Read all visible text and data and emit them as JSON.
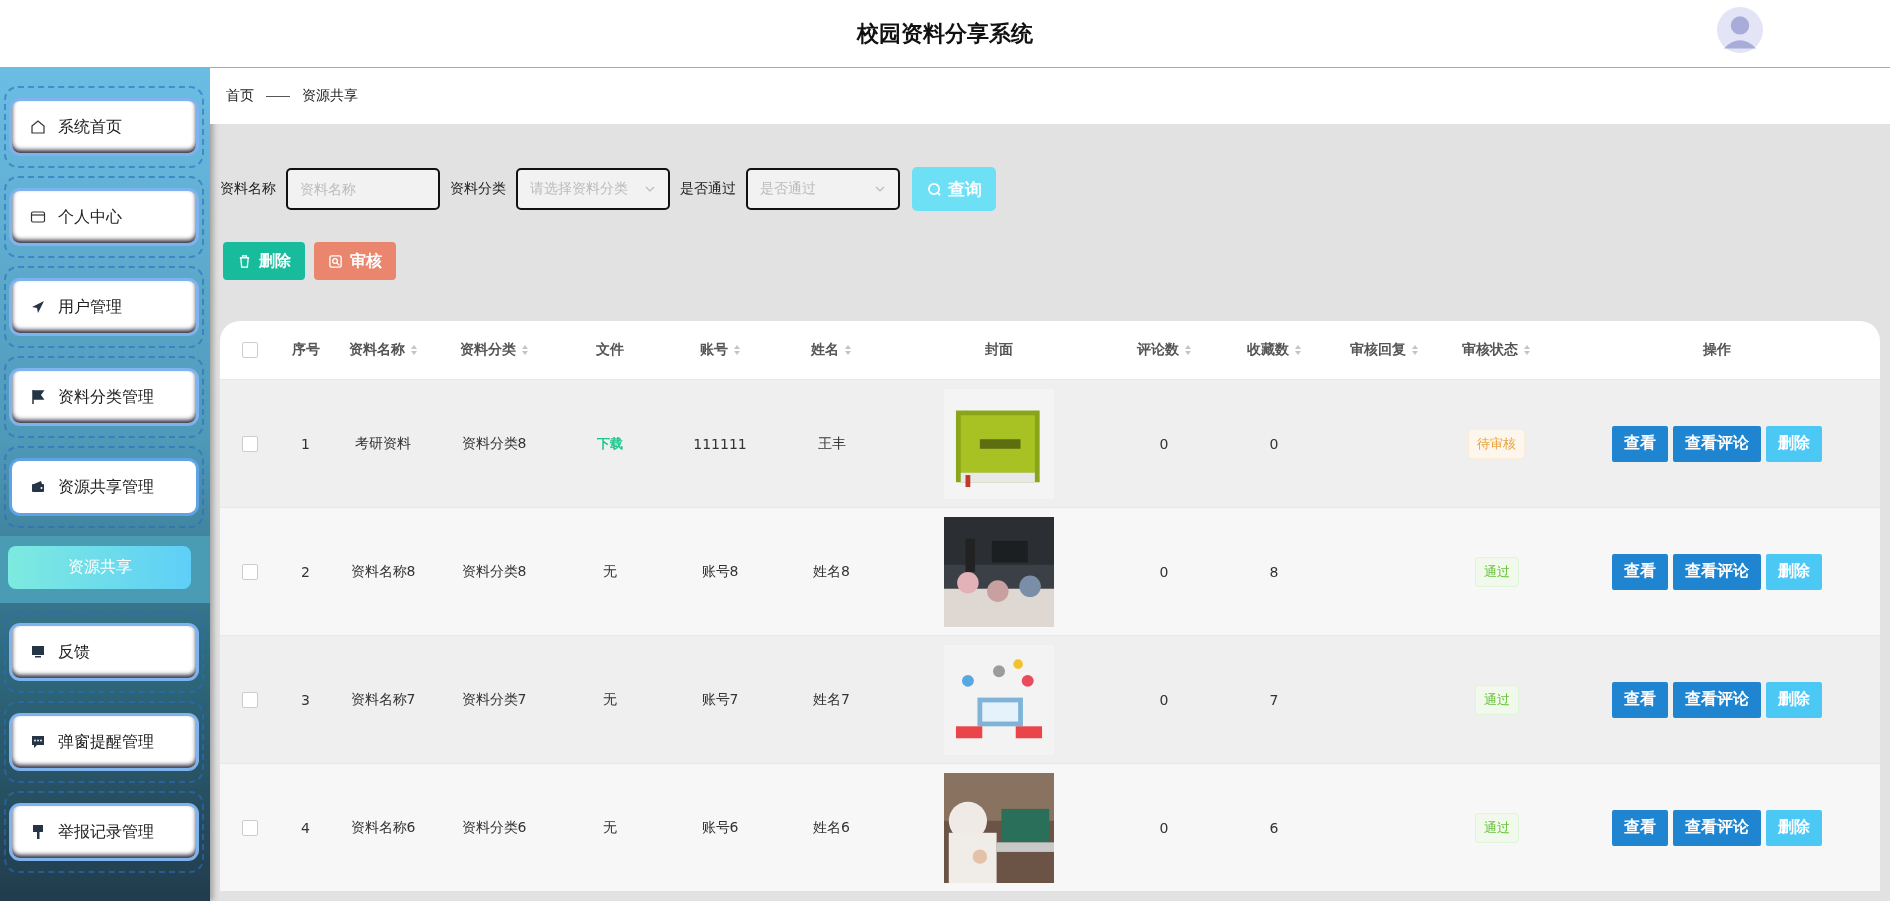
{
  "header": {
    "title": "校园资料分享系统"
  },
  "sidebar": {
    "items": [
      {
        "label": "系统首页",
        "expanded": false
      },
      {
        "label": "个人中心",
        "expanded": false
      },
      {
        "label": "用户管理",
        "expanded": false
      },
      {
        "label": "资料分类管理",
        "expanded": false
      },
      {
        "label": "资源共享管理",
        "expanded": true,
        "children": [
          {
            "label": "资源共享",
            "selected": true
          }
        ]
      },
      {
        "label": "反馈",
        "expanded": false
      },
      {
        "label": "弹窗提醒管理",
        "expanded": false
      },
      {
        "label": "举报记录管理",
        "expanded": false
      }
    ]
  },
  "breadcrumb": [
    "首页",
    "资源共享"
  ],
  "search": {
    "fields": [
      {
        "label": "资料名称",
        "placeholder": "资料名称",
        "kind": "text"
      },
      {
        "label": "资料分类",
        "placeholder": "请选择资料分类",
        "kind": "select"
      },
      {
        "label": "是否通过",
        "placeholder": "是否通过",
        "kind": "select"
      }
    ],
    "button": "查询"
  },
  "actions": [
    {
      "label": "删除",
      "kind": "delete"
    },
    {
      "label": "审核",
      "kind": "review"
    }
  ],
  "table": {
    "header_checked": false,
    "columns": [
      {
        "label": "序号",
        "sortable": false
      },
      {
        "label": "资料名称",
        "sortable": true
      },
      {
        "label": "资料分类",
        "sortable": true
      },
      {
        "label": "文件",
        "sortable": false
      },
      {
        "label": "账号",
        "sortable": true
      },
      {
        "label": "姓名",
        "sortable": true
      },
      {
        "label": "封面",
        "sortable": false
      },
      {
        "label": "评论数",
        "sortable": true
      },
      {
        "label": "收藏数",
        "sortable": true
      },
      {
        "label": "审核回复",
        "sortable": true
      },
      {
        "label": "审核状态",
        "sortable": true
      },
      {
        "label": "操作",
        "sortable": false
      }
    ],
    "rows": [
      {
        "checked": false,
        "no": "1",
        "name": "考研资料",
        "category": "资料分类8",
        "file": "下载",
        "file_link": true,
        "account": "111111",
        "person": "王丰",
        "cover": {
          "kind": "picture"
        },
        "comments": "0",
        "favorites": "0",
        "status": "待审核",
        "approved": false,
        "buttons": [
          "查看",
          "查看评论",
          "删除"
        ]
      },
      {
        "checked": false,
        "no": "2",
        "name": "资料名称8",
        "category": "资料分类8",
        "file": "无",
        "file_link": false,
        "account": "账号8",
        "person": "姓名8",
        "cover": {
          "kind": "picture"
        },
        "comments": "0",
        "favorites": "8",
        "status": "通过",
        "approved": true,
        "buttons": [
          "查看",
          "查看评论",
          "删除"
        ]
      },
      {
        "checked": false,
        "no": "3",
        "name": "资料名称7",
        "category": "资料分类7",
        "file": "无",
        "file_link": false,
        "account": "账号7",
        "person": "姓名7",
        "cover": {
          "kind": "picture"
        },
        "comments": "0",
        "favorites": "7",
        "status": "通过",
        "approved": true,
        "buttons": [
          "查看",
          "查看评论",
          "删除"
        ]
      },
      {
        "checked": false,
        "no": "4",
        "name": "资料名称6",
        "category": "资料分类6",
        "file": "无",
        "file_link": false,
        "account": "账号6",
        "person": "姓名6",
        "cover": {
          "kind": "picture"
        },
        "comments": "0",
        "favorites": "6",
        "status": "通过",
        "approved": true,
        "buttons": [
          "查看",
          "查看评论",
          "删除"
        ]
      }
    ]
  }
}
